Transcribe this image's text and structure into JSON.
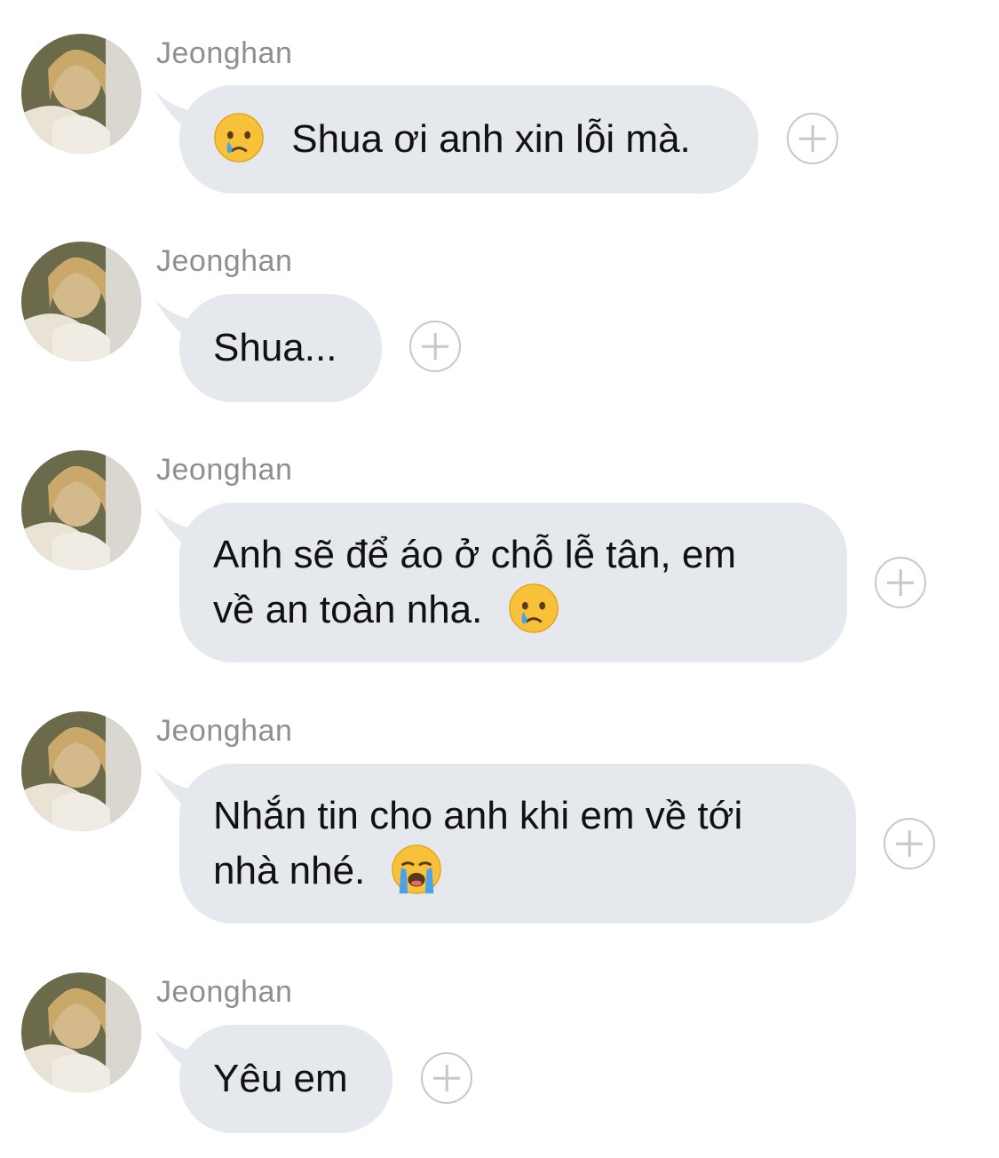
{
  "thread": {
    "messages": [
      {
        "sender": "Jeonghan",
        "text_before_emoji": "",
        "text": "Shua ơi anh xin lỗi mà.",
        "emoji": "crying-face"
      },
      {
        "sender": "Jeonghan",
        "text": "Shua..."
      },
      {
        "sender": "Jeonghan",
        "line1": "Anh sẽ để áo ở chỗ lễ tân, em",
        "line2": "về an toàn nha.",
        "emoji": "crying-face"
      },
      {
        "sender": "Jeonghan",
        "line1": "Nhắn tin cho anh khi em về tới",
        "line2": "nhà nhé.",
        "emoji": "loudly-crying-face"
      },
      {
        "sender": "Jeonghan",
        "text": "Yêu em"
      }
    ]
  },
  "colors": {
    "bubble": "#e5e8ec",
    "sender": "#8e8e93",
    "plus": "#c7c7cc"
  }
}
